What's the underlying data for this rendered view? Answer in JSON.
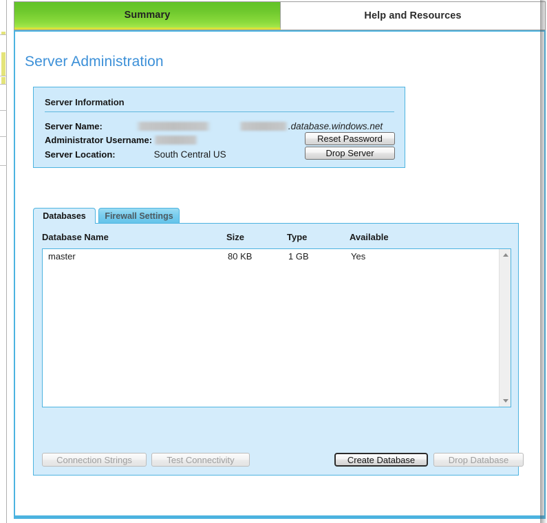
{
  "top_tabs": [
    {
      "label": "Summary",
      "active": true
    },
    {
      "label": "Help and Resources",
      "active": false
    }
  ],
  "page": {
    "title": "Server Administration"
  },
  "server_information": {
    "heading": "Server Information",
    "rows": [
      {
        "label": "Server Name:",
        "value": "",
        "redacted": true,
        "suffix": ".database.windows.net"
      },
      {
        "label": "Administrator Username:",
        "value": "",
        "redacted": true,
        "suffix": ""
      },
      {
        "label": "Server Location:",
        "value": "South Central US",
        "redacted": false,
        "suffix": ""
      }
    ],
    "buttons": [
      {
        "label": "Reset Password",
        "enabled": true
      },
      {
        "label": "Drop Server",
        "enabled": true
      }
    ]
  },
  "db_section": {
    "tabs": [
      {
        "label": "Databases",
        "active": true
      },
      {
        "label": "Firewall Settings",
        "active": false
      }
    ],
    "columns": [
      "Database Name",
      "Size",
      "Type",
      "Available"
    ],
    "rows": [
      {
        "name": "master",
        "size": "80 KB",
        "type": "1 GB",
        "available": "Yes"
      }
    ],
    "footer_buttons": [
      {
        "label": "Connection Strings",
        "enabled": false,
        "default": false
      },
      {
        "label": "Test Connectivity",
        "enabled": false,
        "default": false
      },
      {
        "label": "Create Database",
        "enabled": true,
        "default": true
      },
      {
        "label": "Drop Database",
        "enabled": false,
        "default": false
      }
    ]
  },
  "colors": {
    "tab_active_green": "#6ec82d",
    "tab_underline_yellow": "#dbe03a",
    "accent_blue": "#4cb3e0",
    "title_blue": "#3c90d8",
    "panel_fill": "#cfeafb",
    "db_panel_fill": "#d4ecfb"
  }
}
